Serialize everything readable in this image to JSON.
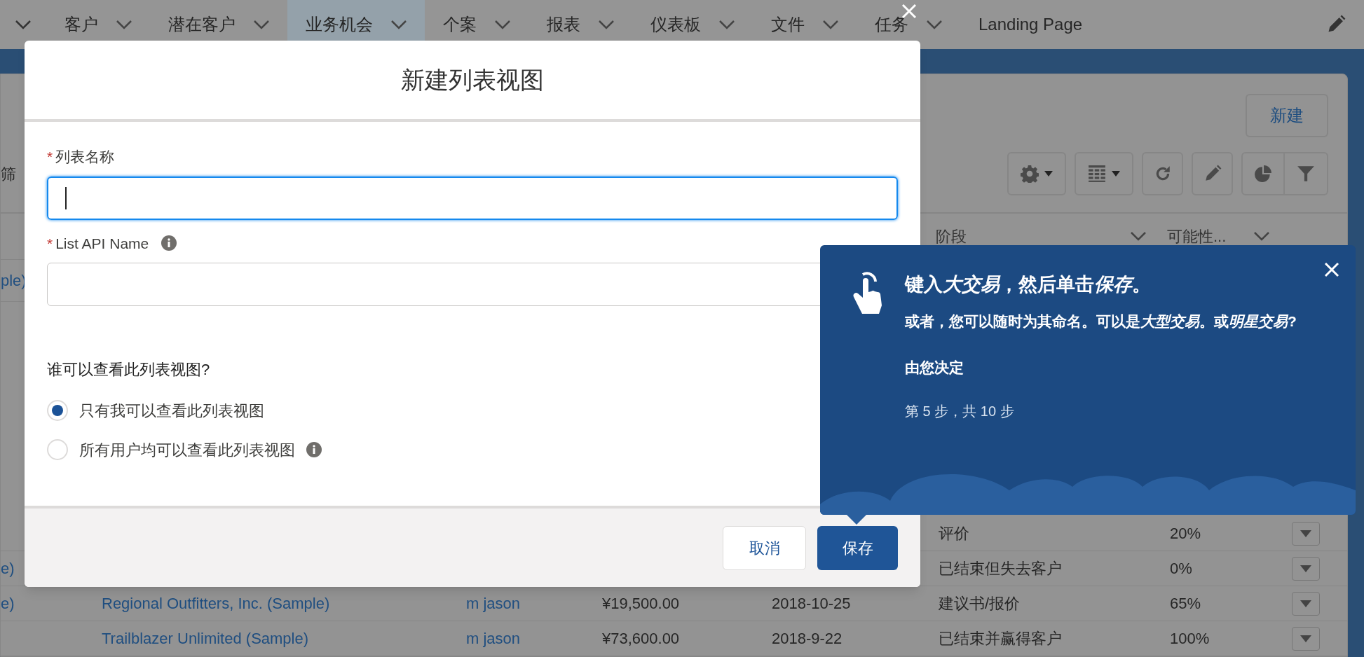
{
  "nav": {
    "items": [
      {
        "label": "客户",
        "has_menu": true,
        "selected": false
      },
      {
        "label": "潜在客户",
        "has_menu": true,
        "selected": false
      },
      {
        "label": "业务机会",
        "has_menu": true,
        "selected": true
      },
      {
        "label": "个案",
        "has_menu": true,
        "selected": false
      },
      {
        "label": "报表",
        "has_menu": true,
        "selected": false
      },
      {
        "label": "仪表板",
        "has_menu": true,
        "selected": false
      },
      {
        "label": "文件",
        "has_menu": true,
        "selected": false
      },
      {
        "label": "任务",
        "has_menu": true,
        "selected": false
      },
      {
        "label": "Landing Page",
        "has_menu": false,
        "selected": false
      }
    ]
  },
  "page": {
    "filter_label": "筛",
    "new_button": "新建",
    "columns": [
      {
        "label": "阶段"
      },
      {
        "label": "可能性..."
      }
    ],
    "rows": [
      {
        "column_1": "ple)",
        "has_menu": false
      },
      {
        "stage": "评价",
        "probability": "20%",
        "has_menu": true
      },
      {
        "column_1": "e)",
        "stage": "已结束但失去客户",
        "probability": "0%",
        "has_menu": true
      },
      {
        "column_1": "e)",
        "account": "Regional Outfitters, Inc. (Sample)",
        "owner": "m jason",
        "amount": "¥19,500.00",
        "close_date": "2018-10-25",
        "stage": "建议书/报价",
        "probability": "65%",
        "has_menu": true
      },
      {
        "account": "Trailblazer Unlimited (Sample)",
        "owner": "m jason",
        "amount": "¥73,600.00",
        "close_date": "2018-9-22",
        "stage": "已结束并赢得客户",
        "probability": "100%",
        "has_menu": true
      }
    ]
  },
  "modal": {
    "title": "新建列表视图",
    "fields": [
      {
        "required_mark": "*",
        "label": "列表名称",
        "focused": true,
        "info": false
      },
      {
        "required_mark": "*",
        "label": "List API Name",
        "focused": false,
        "info": true
      }
    ],
    "visibility": {
      "question": "谁可以查看此列表视图?",
      "options": [
        {
          "label": "只有我可以查看此列表视图",
          "selected": true,
          "info": false
        },
        {
          "label": "所有用户均可以查看此列表视图",
          "selected": false,
          "info": true
        }
      ]
    },
    "buttons": [
      {
        "label": "取消",
        "kind": "neutral"
      },
      {
        "label": "保存",
        "kind": "brand"
      }
    ]
  },
  "guide": {
    "title": [
      {
        "text": "键入",
        "italic": false
      },
      {
        "text": "大交易",
        "italic": true
      },
      {
        "text": "，然后单击",
        "italic": false
      },
      {
        "text": "保存",
        "italic": true
      },
      {
        "text": "。",
        "italic": false
      }
    ],
    "body": [
      {
        "text": "或者，您可以随时为其命名。可以是",
        "italic": false
      },
      {
        "text": "大型交易",
        "italic": true
      },
      {
        "text": "。或",
        "italic": false
      },
      {
        "text": "明星交易",
        "italic": true
      },
      {
        "text": "?",
        "italic": false
      }
    ],
    "note": "由您决定",
    "progress": "第 5 步，共 10 步"
  }
}
